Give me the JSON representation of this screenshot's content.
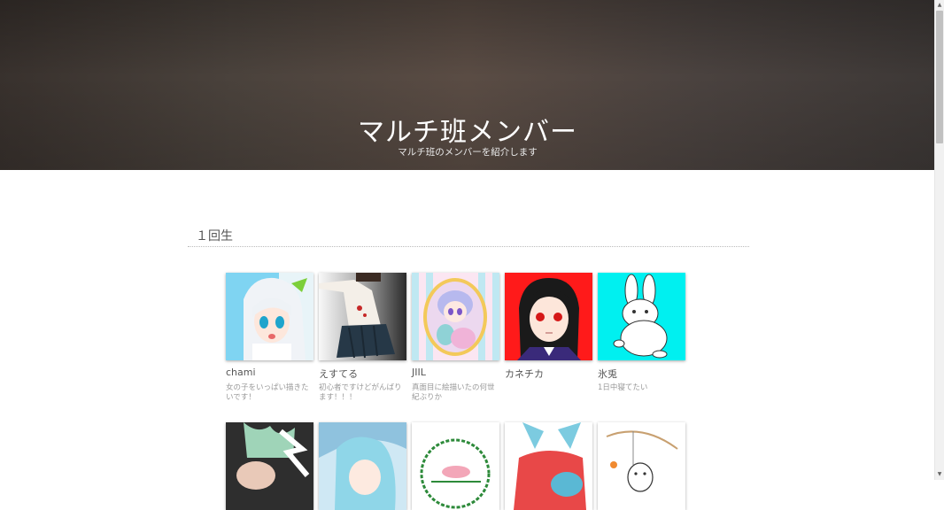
{
  "hero": {
    "title": "マルチ班メンバー",
    "subtitle": "マルチ班のメンバーを紹介します"
  },
  "section": {
    "heading": "１回生"
  },
  "members_row1": [
    {
      "name": "chami",
      "desc": "女の子をいっぱい描きたいです！"
    },
    {
      "name": "えすてる",
      "desc": "初心者ですけどがんばります！！！"
    },
    {
      "name": "JIIL",
      "desc": "真面目に絵描いたの何世紀ぶりか"
    },
    {
      "name": "カネチカ",
      "desc": ""
    },
    {
      "name": "氷兎",
      "desc": "1日中寝てたい"
    }
  ],
  "colors": {
    "hero_bg": "#4a423c",
    "accent_red": "#ff1a1a",
    "accent_cyan": "#00f0f0"
  }
}
